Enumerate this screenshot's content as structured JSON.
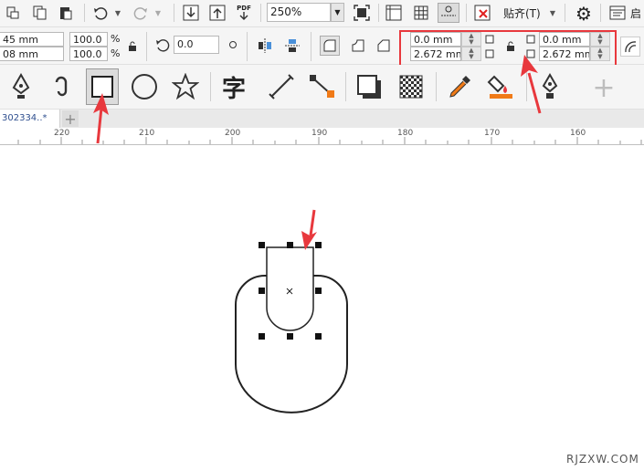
{
  "toolbar": {
    "zoom": "250%",
    "align_label": "贴齐(T)",
    "launch_label": "启",
    "pdf_label": "PDF"
  },
  "props": {
    "pos_x": "45 mm",
    "pos_y": "08 mm",
    "scale_x": "100.0",
    "scale_y": "100.0",
    "percent": "%",
    "rotation": "0.0",
    "corner_tl": "0.0 mm",
    "corner_bl": "2.672 mm",
    "corner_tr": "0.0 mm",
    "corner_br": "2.672 mm"
  },
  "tabs": {
    "doc_tab": "302334..*",
    "add": "+"
  },
  "ruler": {
    "labels": [
      "220",
      "210",
      "200",
      "190",
      "180",
      "170",
      "160"
    ]
  },
  "watermark": "RJZXW.COM",
  "colors": {
    "highlight": "#e8383d",
    "arrow": "#e8383d",
    "orange": "#f07a17"
  }
}
